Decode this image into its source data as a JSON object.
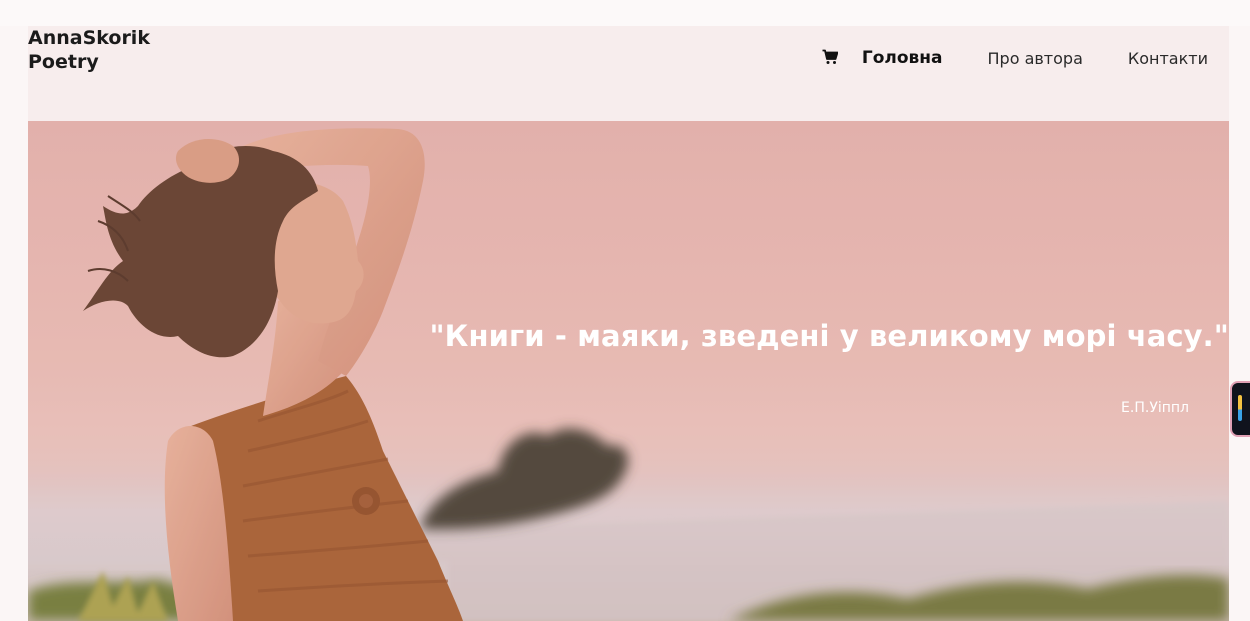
{
  "site": {
    "logo_line1": "AnnaSkorik",
    "logo_line2": "Poetry"
  },
  "nav": {
    "cart_icon": "cart-icon",
    "items": [
      {
        "label": "Головна",
        "active": true
      },
      {
        "label": "Про автора",
        "active": false
      },
      {
        "label": "Контакти",
        "active": false
      }
    ]
  },
  "hero": {
    "quote": "\"Книги - маяки, зведені у великому морі часу.\"",
    "author": "Е.П.Уіппл"
  },
  "colors": {
    "page_background": "#fbf6f6",
    "header_background": "#f7eded",
    "hero_tint": "#e2b2ae",
    "quote_text": "#ffffff"
  }
}
